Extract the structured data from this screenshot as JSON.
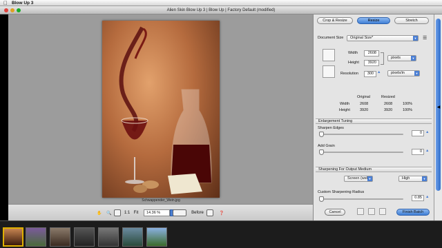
{
  "menubar": {
    "apple": "",
    "app_name": "Blow Up 3"
  },
  "window": {
    "title": "Alien Skin Blow Up 3 | Blow Up | Factory Default (modified)"
  },
  "canvas": {
    "caption": "Schwappender_Wein.jpg"
  },
  "bottombar": {
    "zoom_ratio": "1:1",
    "fit_label": "Fit",
    "zoom_value": "14.36 %",
    "before_label": "Before"
  },
  "tabs": [
    {
      "label": "Crop & Resize",
      "active": false
    },
    {
      "label": "Resize",
      "active": true
    },
    {
      "label": "Stretch",
      "active": false
    }
  ],
  "resize": {
    "document_size_label": "Document Size",
    "document_size_value": "Original Size*",
    "width_label": "Width",
    "width_value": "2608",
    "width_unit": "pixels",
    "height_label": "Height",
    "height_value": "3920",
    "resolution_label": "Resolution",
    "resolution_value": "300",
    "resolution_unit": "pixels/in"
  },
  "summary": {
    "headers": [
      "Original",
      "Resized"
    ],
    "rows": [
      {
        "label": "Width",
        "original": "2608",
        "resized": "2608",
        "percent": "100%"
      },
      {
        "label": "Height",
        "original": "3920",
        "resized": "3920",
        "percent": "100%"
      }
    ]
  },
  "enlargement": {
    "title": "Enlargement Tuning",
    "sharpen_edges_label": "Sharpen Edges",
    "sharpen_edges_value": "0",
    "add_grain_label": "Add Grain",
    "add_grain_value": "0"
  },
  "sharpening": {
    "title": "Sharpening For Output Medium",
    "medium_value": "Screen (web)",
    "level_value": "High",
    "radius_label": "Custom Sharpening Radius",
    "radius_value": "0.85"
  },
  "actions": {
    "cancel": "Cancel",
    "finish": "Finish Batch"
  },
  "colors": {
    "accent": "#3f7fd6",
    "selection": "#e0b000"
  }
}
